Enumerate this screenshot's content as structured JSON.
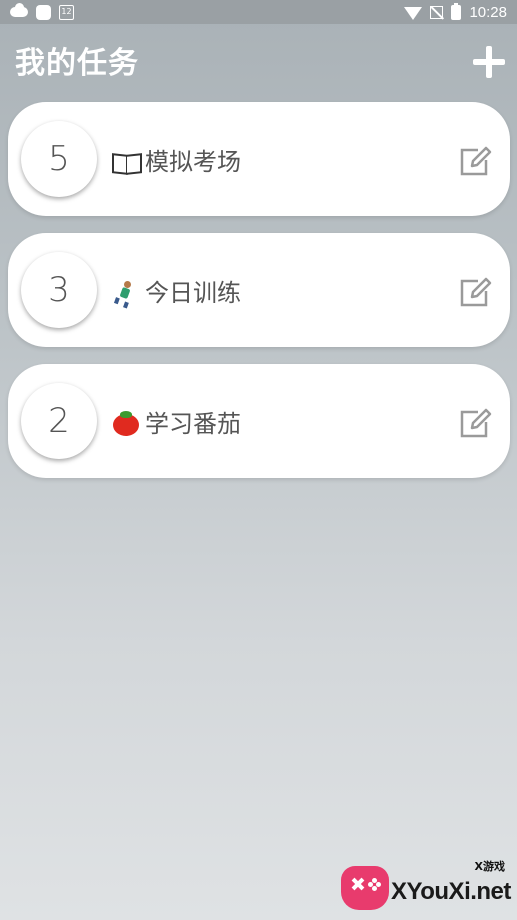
{
  "status_bar": {
    "calendar_day": "12",
    "time": "10:28",
    "icons": [
      "cloud-icon",
      "app-icon",
      "calendar-icon",
      "wifi-icon",
      "no-signal-icon",
      "battery-icon"
    ]
  },
  "header": {
    "title": "我的任务",
    "add_icon": "plus-icon"
  },
  "tasks": [
    {
      "count": "5",
      "emoji": "book-icon",
      "name": "模拟考场",
      "edit_icon": "edit-icon"
    },
    {
      "count": "3",
      "emoji": "runner-icon",
      "name": "今日训练",
      "edit_icon": "edit-icon"
    },
    {
      "count": "2",
      "emoji": "tomato-icon",
      "name": "学习番茄",
      "edit_icon": "edit-icon"
    }
  ],
  "watermark": {
    "tag": "X游戏",
    "text": "XYouXi.net"
  },
  "colors": {
    "card": "#ffffff",
    "text": "#555555",
    "header_text": "#ffffff"
  }
}
